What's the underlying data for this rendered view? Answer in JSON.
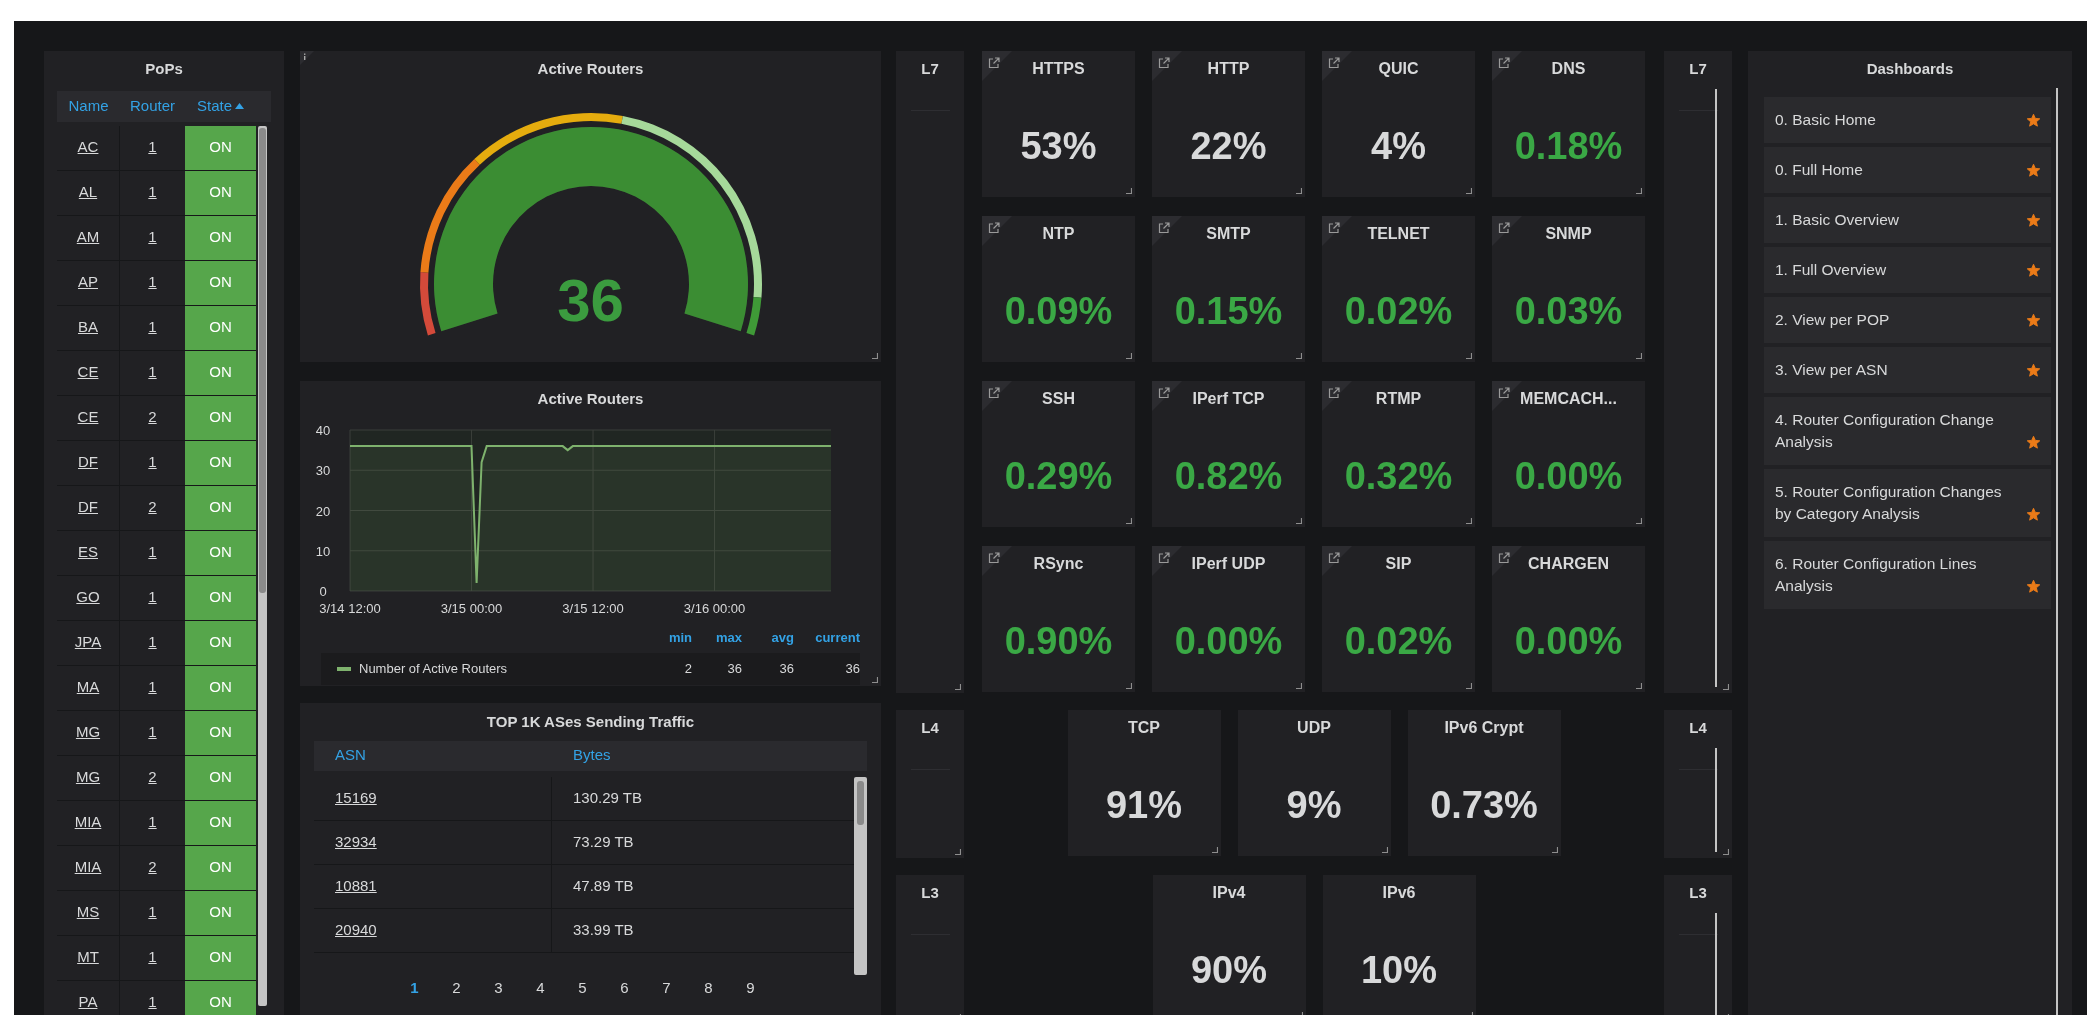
{
  "pops": {
    "title": "PoPs",
    "columns": [
      {
        "label": "Name",
        "sorted": false
      },
      {
        "label": "Router",
        "sorted": false
      },
      {
        "label": "State",
        "sorted": true
      }
    ],
    "rows": [
      {
        "name": "AC",
        "router": "1",
        "state": "ON"
      },
      {
        "name": "AL",
        "router": "1",
        "state": "ON"
      },
      {
        "name": "AM",
        "router": "1",
        "state": "ON"
      },
      {
        "name": "AP",
        "router": "1",
        "state": "ON"
      },
      {
        "name": "BA",
        "router": "1",
        "state": "ON"
      },
      {
        "name": "CE",
        "router": "1",
        "state": "ON"
      },
      {
        "name": "CE",
        "router": "2",
        "state": "ON"
      },
      {
        "name": "DF",
        "router": "1",
        "state": "ON"
      },
      {
        "name": "DF",
        "router": "2",
        "state": "ON"
      },
      {
        "name": "ES",
        "router": "1",
        "state": "ON"
      },
      {
        "name": "GO",
        "router": "1",
        "state": "ON"
      },
      {
        "name": "JPA",
        "router": "1",
        "state": "ON"
      },
      {
        "name": "MA",
        "router": "1",
        "state": "ON"
      },
      {
        "name": "MG",
        "router": "1",
        "state": "ON"
      },
      {
        "name": "MG",
        "router": "2",
        "state": "ON"
      },
      {
        "name": "MIA",
        "router": "1",
        "state": "ON"
      },
      {
        "name": "MIA",
        "router": "2",
        "state": "ON"
      },
      {
        "name": "MS",
        "router": "1",
        "state": "ON"
      },
      {
        "name": "MT",
        "router": "1",
        "state": "ON"
      },
      {
        "name": "PA",
        "router": "1",
        "state": "ON"
      }
    ]
  },
  "gauge": {
    "title": "Active Routers",
    "value": "36",
    "level": 1
  },
  "graph": {
    "title": "Active Routers",
    "chart_data": {
      "type": "area",
      "categories": [
        "3/14 12:00",
        null,
        null,
        null,
        null,
        null,
        null,
        null,
        null,
        null,
        null,
        null,
        null,
        null,
        null,
        null,
        null,
        null,
        null,
        null,
        null,
        null,
        null,
        null,
        "3/15 00:00",
        null,
        null,
        null,
        null,
        null,
        null,
        null,
        null,
        null,
        null,
        null,
        null,
        null,
        null,
        null,
        null,
        null,
        null,
        null,
        null,
        null,
        null,
        null,
        "3/15 12:00",
        null,
        null,
        null,
        null,
        null,
        null,
        null,
        null,
        null,
        null,
        null,
        null,
        null,
        null,
        null,
        null,
        null,
        null,
        null,
        null,
        null,
        null,
        null,
        "3/16 00:00",
        null,
        null,
        null,
        null,
        null,
        null,
        null,
        null,
        null,
        null,
        null,
        null,
        null,
        null,
        null,
        null,
        null,
        null,
        null,
        null,
        null,
        null,
        null
      ],
      "series": [
        {
          "name": "Number of Active Routers",
          "color": "#7eb26d",
          "values": [
            36,
            36,
            36,
            36,
            36,
            36,
            36,
            36,
            36,
            36,
            36,
            36,
            36,
            36,
            36,
            36,
            36,
            36,
            36,
            36,
            36,
            36,
            36,
            36,
            36,
            2,
            32,
            36,
            36,
            36,
            36,
            36,
            36,
            36,
            36,
            36,
            36,
            36,
            36,
            36,
            36,
            36,
            36,
            35,
            36,
            36,
            36,
            36,
            36,
            36,
            36,
            36,
            36,
            36,
            36,
            36,
            36,
            36,
            36,
            36,
            36,
            36,
            36,
            36,
            36,
            36,
            36,
            36,
            36,
            36,
            36,
            36,
            36,
            36,
            36,
            36,
            36,
            36,
            36,
            36,
            36,
            36,
            36,
            36,
            36,
            36,
            36,
            36,
            36,
            36,
            36,
            36,
            36,
            36,
            36,
            36
          ]
        }
      ],
      "ylim": [
        0,
        40
      ],
      "yticks": [
        0,
        10,
        20,
        30,
        40
      ],
      "grid": true
    },
    "legend": {
      "columns": [
        "min",
        "max",
        "avg",
        "current"
      ],
      "values": [
        "2",
        "36",
        "36",
        "36"
      ]
    }
  },
  "asn_table": {
    "title": "TOP 1K ASes Sending Traffic",
    "columns": [
      "ASN",
      "Bytes"
    ],
    "rows": [
      {
        "asn": "15169",
        "bytes": "130.29 TB"
      },
      {
        "asn": "32934",
        "bytes": "73.29 TB"
      },
      {
        "asn": "10881",
        "bytes": "47.89 TB"
      },
      {
        "asn": "20940",
        "bytes": "33.99 TB"
      }
    ],
    "pages": [
      {
        "label": "1",
        "selected": true
      },
      {
        "label": "2",
        "selected": false
      },
      {
        "label": "3",
        "selected": false
      },
      {
        "label": "4",
        "selected": false
      },
      {
        "label": "5",
        "selected": false
      },
      {
        "label": "6",
        "selected": false
      },
      {
        "label": "7",
        "selected": false
      },
      {
        "label": "8",
        "selected": false
      },
      {
        "label": "9",
        "selected": false
      }
    ]
  },
  "layers": [
    {
      "left": "L7",
      "right": "L7",
      "tiles": [
        {
          "title": "HTTPS",
          "value": "53%",
          "color": "#d8d9da",
          "link": true
        },
        {
          "title": "HTTP",
          "value": "22%",
          "color": "#d8d9da",
          "link": true
        },
        {
          "title": "QUIC",
          "value": "4%",
          "color": "#d8d9da",
          "link": true
        },
        {
          "title": "DNS",
          "value": "0.18%",
          "color": "#3aa845",
          "link": true
        },
        {
          "title": "NTP",
          "value": "0.09%",
          "color": "#3aa845",
          "link": true
        },
        {
          "title": "SMTP",
          "value": "0.15%",
          "color": "#3aa845",
          "link": true
        },
        {
          "title": "TELNET",
          "value": "0.02%",
          "color": "#3aa845",
          "link": true
        },
        {
          "title": "SNMP",
          "value": "0.03%",
          "color": "#3aa845",
          "link": true
        },
        {
          "title": "SSH",
          "value": "0.29%",
          "color": "#3aa845",
          "link": true
        },
        {
          "title": "IPerf TCP",
          "value": "0.82%",
          "color": "#3aa845",
          "link": true
        },
        {
          "title": "RTMP",
          "value": "0.32%",
          "color": "#3aa845",
          "link": true
        },
        {
          "title": "MEMCACH...",
          "value": "0.00%",
          "color": "#3aa845",
          "link": true
        },
        {
          "title": "RSync",
          "value": "0.90%",
          "color": "#3aa845",
          "link": true
        },
        {
          "title": "IPerf UDP",
          "value": "0.00%",
          "color": "#3aa845",
          "link": true
        },
        {
          "title": "SIP",
          "value": "0.02%",
          "color": "#3aa845",
          "link": true
        },
        {
          "title": "CHARGEN",
          "value": "0.00%",
          "color": "#3aa845",
          "link": true
        }
      ]
    },
    {
      "left": "L4",
      "right": "L4",
      "tiles": [
        {
          "title": "TCP",
          "value": "91%",
          "color": "#d8d9da",
          "link": false
        },
        {
          "title": "UDP",
          "value": "9%",
          "color": "#d8d9da",
          "link": false
        },
        {
          "title": "IPv6 Crypt",
          "value": "0.73%",
          "color": "#d8d9da",
          "link": false
        }
      ]
    },
    {
      "left": "L3",
      "right": "L3",
      "tiles": [
        {
          "title": "IPv4",
          "value": "90%",
          "color": "#d8d9da",
          "link": false
        },
        {
          "title": "IPv6",
          "value": "10%",
          "color": "#d8d9da",
          "link": false
        }
      ]
    }
  ],
  "dashboards": {
    "title": "Dashboards",
    "items": [
      {
        "label": "0. Basic Home",
        "starred": true
      },
      {
        "label": "0. Full Home",
        "starred": true
      },
      {
        "label": "1. Basic Overview",
        "starred": true
      },
      {
        "label": "1. Full Overview",
        "starred": true
      },
      {
        "label": "2. View per POP",
        "starred": true
      },
      {
        "label": "3. View per ASN",
        "starred": true
      },
      {
        "label": "4. Router Configuration Change Analysis",
        "starred": true
      },
      {
        "label": "5. Router Configuration Changes by Category Analysis",
        "starred": true
      },
      {
        "label": "6. Router Configuration Lines Analysis",
        "starred": true
      }
    ]
  }
}
